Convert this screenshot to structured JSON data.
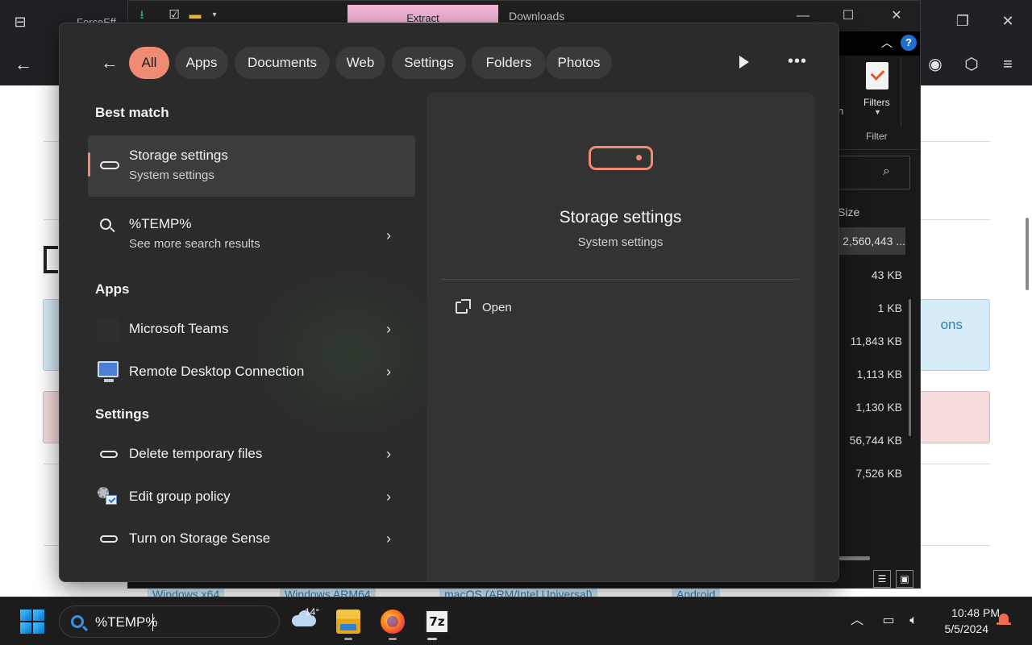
{
  "browser": {
    "tab_title": "ForceEff",
    "blue_notice_fragment": "ons",
    "download_buttons": [
      "Windows x64",
      "Windows ARM64",
      "macOS (ARM/Intel Universal)",
      "Android"
    ]
  },
  "explorer": {
    "extract_tab": "Extract",
    "title": "Downloads",
    "ribbon_partial_label": "n",
    "filters_label": "Filters",
    "filter_group_label": "Filter",
    "size_column_label": "Size",
    "sizes": [
      "2,560,443 ...",
      "43 KB",
      "1 KB",
      "11,843 KB",
      "1,113 KB",
      "1,130 KB",
      "56,744 KB",
      "7,526 KB"
    ],
    "help_label": "?"
  },
  "search": {
    "filters": [
      "All",
      "Apps",
      "Documents",
      "Web",
      "Settings",
      "Folders",
      "Photos"
    ],
    "active_filter": "All",
    "best_match_heading": "Best match",
    "best_match": {
      "title": "Storage settings",
      "subtitle": "System settings"
    },
    "web_result": {
      "title": "%TEMP%",
      "subtitle": "See more search results"
    },
    "apps_heading": "Apps",
    "apps": [
      "Microsoft Teams",
      "Remote Desktop Connection"
    ],
    "settings_heading": "Settings",
    "settings": [
      "Delete temporary files",
      "Edit group policy",
      "Turn on Storage Sense"
    ],
    "preview": {
      "title": "Storage settings",
      "subtitle": "System settings",
      "open_label": "Open"
    },
    "accent_color": "#f08b73"
  },
  "taskbar": {
    "search_query": "%TEMP%",
    "weather_temp": "14°",
    "apps": [
      "file-explorer",
      "firefox",
      "7-zip"
    ],
    "time": "10:48 PM",
    "date": "5/5/2024"
  }
}
